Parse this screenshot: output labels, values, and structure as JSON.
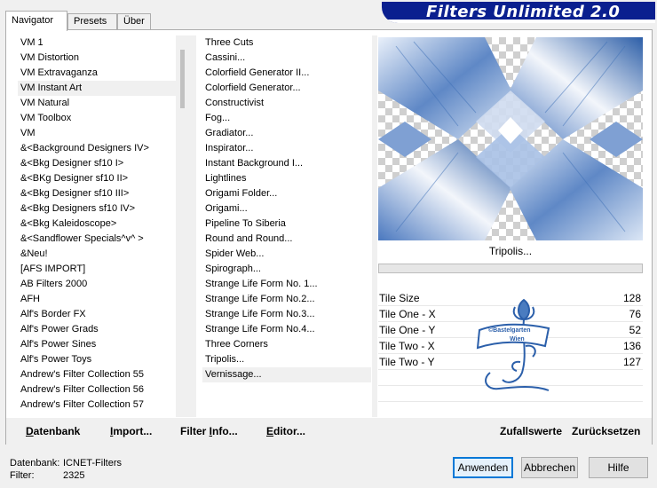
{
  "header": {
    "title": "Filters Unlimited 2.0"
  },
  "tabs": [
    {
      "label": "Navigator"
    },
    {
      "label": "Presets"
    },
    {
      "label": "Über"
    }
  ],
  "categories": {
    "selected_index": 3,
    "items": [
      "VM 1",
      "VM Distortion",
      "VM Extravaganza",
      "VM Instant Art",
      "VM Natural",
      "VM Toolbox",
      "VM",
      "&<Background Designers IV>",
      "&<Bkg Designer sf10 I>",
      "&<BKg Designer sf10 II>",
      "&<Bkg Designer sf10 III>",
      "&<Bkg Designers sf10 IV>",
      "&<Bkg Kaleidoscope>",
      "&<Sandflower Specials^v^ >",
      "&Neu!",
      "[AFS IMPORT]",
      "AB Filters 2000",
      "AFH",
      "Alf's Border FX",
      "Alf's Power Grads",
      "Alf's Power Sines",
      "Alf's Power Toys",
      "Andrew's Filter Collection 55",
      "Andrew's Filter Collection 56",
      "Andrew's Filter Collection 57"
    ]
  },
  "filters": {
    "selected_index": 22,
    "items": [
      "Three Cuts",
      "Cassini...",
      "Colorfield Generator II...",
      "Colorfield Generator...",
      "Constructivist",
      "Fog...",
      "Gradiator...",
      "Inspirator...",
      "Instant Background I...",
      "Lightlines",
      "Origami Folder...",
      "Origami...",
      "Pipeline To Siberia",
      "Round and Round...",
      "Spider Web...",
      "Spirograph...",
      "Strange Life Form No. 1...",
      "Strange Life Form No.2...",
      "Strange Life Form No.3...",
      "Strange Life Form No.4...",
      "Three Corners",
      "Tripolis...",
      "Vernissage..."
    ]
  },
  "current_filter": {
    "name": "Tripolis..."
  },
  "params": [
    {
      "label": "Tile Size",
      "value": "128"
    },
    {
      "label": "Tile One - X",
      "value": "76"
    },
    {
      "label": "Tile One - Y",
      "value": "52"
    },
    {
      "label": "Tile Two - X",
      "value": "136"
    },
    {
      "label": "Tile Two - Y",
      "value": "127"
    }
  ],
  "watermark": {
    "line1": "©Bastelgarten",
    "line2": "Wien"
  },
  "bottom_links": {
    "datenbank": "atenbank",
    "datenbank_u": "D",
    "import": "mport...",
    "import_pre": "I",
    "filter_info_pre": "Filter ",
    "filter_info_u": "I",
    "filter_info_post": "nfo...",
    "editor_pre": "",
    "editor_u": "E",
    "editor_post": "ditor...",
    "random": "Zufallswerte",
    "reset": "Zurücksetzen"
  },
  "footer": {
    "db_label": "Datenbank:",
    "db_value": "ICNET-Filters",
    "filter_label": "Filter:",
    "filter_value": "2325"
  },
  "buttons": {
    "apply": "Anwenden",
    "cancel": "Abbrechen",
    "help": "Hilfe"
  },
  "colors": {
    "banner": "#0a1f8f",
    "tile_blue": "#3d6fb6",
    "tile_light": "#dbe6f5"
  }
}
